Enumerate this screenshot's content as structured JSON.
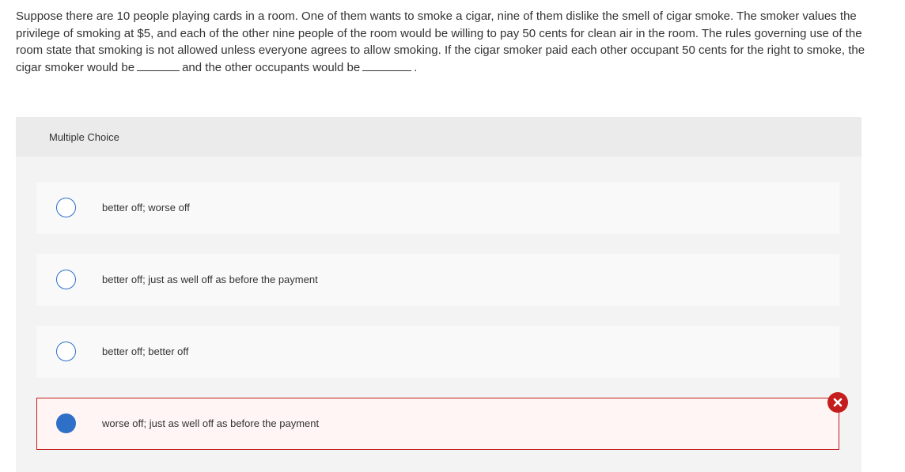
{
  "question": {
    "text_part1": "Suppose there are 10 people playing cards in a room. One of them wants to smoke a cigar, nine of them dislike the smell of cigar smoke. The smoker values the privilege of smoking at $5, and each of the other nine people of the room would be willing to pay 50 cents for clean air in the room. The rules governing use of the room state that smoking is not allowed unless everyone agrees to allow smoking. If the cigar smoker paid each other occupant 50 cents for the right to smoke, the cigar smoker would be",
    "text_part2": "and the other occupants would be",
    "text_part3": "."
  },
  "panel": {
    "header_label": "Multiple Choice"
  },
  "choices": [
    {
      "label": "better off; worse off",
      "selected": false
    },
    {
      "label": "better off; just as well off as before the payment",
      "selected": false
    },
    {
      "label": "better off; better off",
      "selected": false
    },
    {
      "label": "worse off; just as well off as before the payment",
      "selected": true
    }
  ],
  "feedback": {
    "icon": "x-icon",
    "status": "incorrect"
  },
  "colors": {
    "radio_accent": "#2e6fc7",
    "incorrect_red": "#c41d1d",
    "panel_background": "#f3f3f3",
    "panel_header_background": "#ebebeb",
    "choice_background": "#f9f9f9",
    "selected_choice_background": "#fff5f5"
  }
}
